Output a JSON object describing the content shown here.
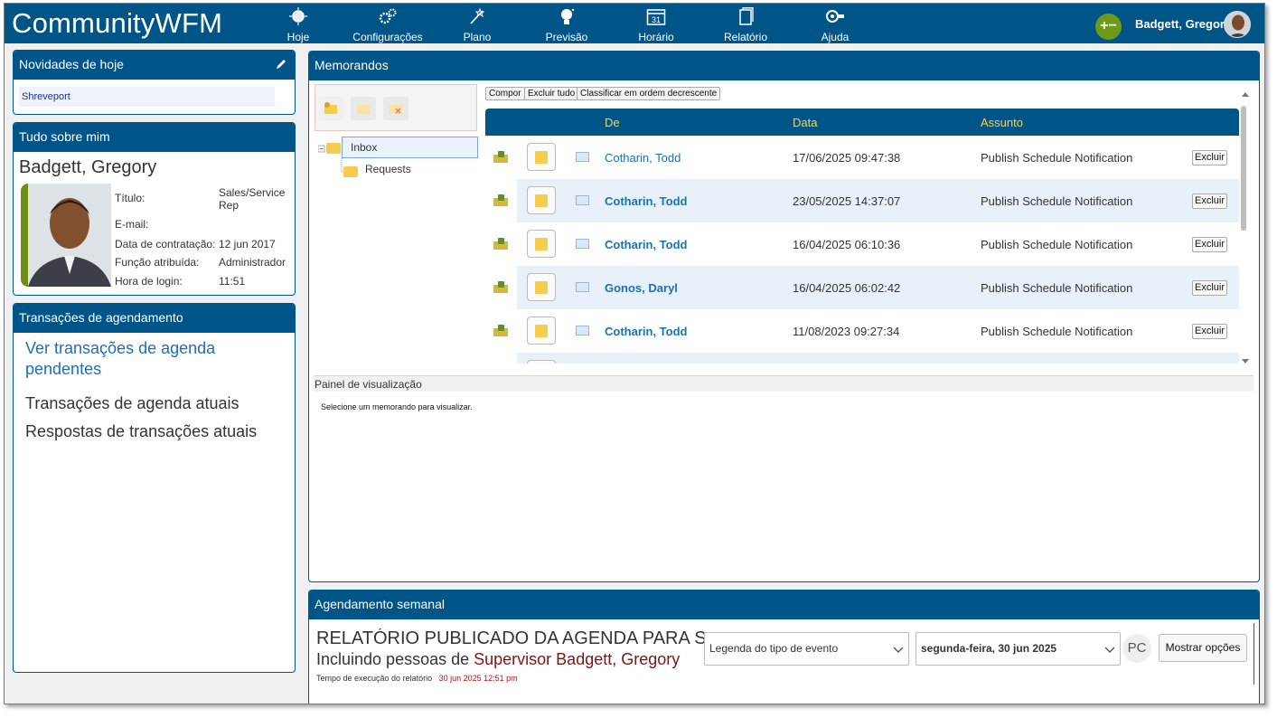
{
  "app": {
    "title": "CommunityWFM"
  },
  "nav": [
    {
      "label": "Hoje",
      "icon": "sun-icon"
    },
    {
      "label": "Configurações",
      "icon": "gears-icon"
    },
    {
      "label": "Plano",
      "icon": "wand-icon"
    },
    {
      "label": "Previsão",
      "icon": "forecast-icon"
    },
    {
      "label": "Horário",
      "icon": "calendar-icon",
      "badge": "31"
    },
    {
      "label": "Relatório",
      "icon": "report-icon"
    },
    {
      "label": "Ajuda",
      "icon": "help-icon"
    }
  ],
  "header": {
    "add_label": "+−",
    "user_name": "Badgett, Gregory"
  },
  "news": {
    "title": "Novidades de hoje",
    "item": "Shreveport"
  },
  "about": {
    "title": "Tudo sobre mim",
    "name": "Badgett, Gregory",
    "fields": [
      {
        "k": "Título:",
        "v": "Sales/Service Rep"
      },
      {
        "k": "E-mail:",
        "v": ""
      },
      {
        "k": "Data de contratação:",
        "v": "12 jun 2017"
      },
      {
        "k": "Função atribuída:",
        "v": "Administrador"
      },
      {
        "k": "Hora de login:",
        "v": "11:51"
      }
    ]
  },
  "transactions": {
    "title": "Transações de agendamento",
    "pending_link": "Ver transações de agenda pendentes",
    "current": "Transações de agenda atuais",
    "responses": "Respostas de transações atuais"
  },
  "memos": {
    "title": "Memorandos",
    "folders": {
      "inbox": "Inbox",
      "requests": "Requests"
    },
    "buttons": {
      "compose": "Compor",
      "delete_all": "Excluir tudo",
      "sort": "Classificar em ordem decrescente"
    },
    "columns": {
      "from": "De",
      "date": "Data",
      "subject": "Assunto"
    },
    "delete_label": "Excluir",
    "rows": [
      {
        "from": "Cotharin, Todd",
        "date": "17/06/2025 09:47:38",
        "subject": "Publish Schedule Notification",
        "unread": false
      },
      {
        "from": "Cotharin, Todd",
        "date": "23/05/2025 14:37:07",
        "subject": "Publish Schedule Notification",
        "unread": true
      },
      {
        "from": "Cotharin, Todd",
        "date": "16/04/2025 06:10:36",
        "subject": "Publish Schedule Notification",
        "unread": true
      },
      {
        "from": "Gonos, Daryl",
        "date": "16/04/2025 06:02:42",
        "subject": "Publish Schedule Notification",
        "unread": true
      },
      {
        "from": "Cotharin, Todd",
        "date": "11/08/2023 09:27:34",
        "subject": "Publish Schedule Notification",
        "unread": true
      }
    ],
    "preview_title": "Painel de visualização",
    "preview_text": "Selecione um memorando para visualizar."
  },
  "weekly": {
    "title": "Agendamento semanal",
    "report_title": "RELATÓRIO PUBLICADO DA AGENDA PARA S",
    "including": "Incluindo pessoas de",
    "supervisor": "Supervisor Badgett, Gregory",
    "exec_label": "Tempo de execução do relatório",
    "exec_time": "30 jun 2025 12:51 pm",
    "legend_select": "Legenda do tipo de evento",
    "date_select": "segunda-feira, 30 jun 2025",
    "pc_label": "PC",
    "options_button": "Mostrar opções"
  },
  "colors": {
    "header": "#005588",
    "accent": "#1f6fb2",
    "header_text_cols": "#ffd24d",
    "add_button": "#6e9a1a"
  }
}
